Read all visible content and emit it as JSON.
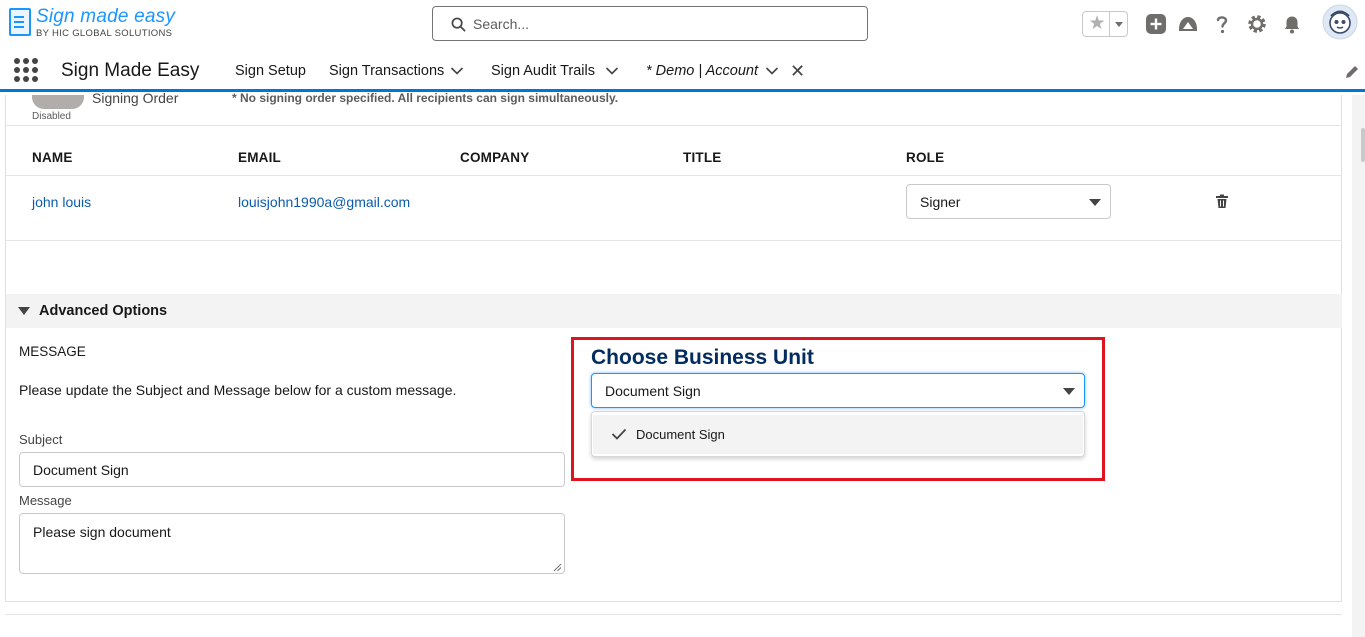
{
  "header": {
    "logo_title": "Sign made easy",
    "logo_subtitle": "BY HIC GLOBAL SOLUTIONS",
    "search_placeholder": "Search...",
    "icons": [
      "star-icon",
      "add-icon",
      "trailhead-icon",
      "help-icon",
      "gear-icon",
      "bell-icon",
      "avatar"
    ]
  },
  "nav": {
    "app_name": "Sign Made Easy",
    "items": [
      {
        "label": "Sign Setup"
      },
      {
        "label": "Sign Transactions"
      },
      {
        "label": "Sign Audit Trails"
      },
      {
        "label": "* Demo | Account"
      }
    ]
  },
  "signing_order": {
    "label": "Signing Order",
    "status": "Disabled",
    "note": "* No signing order specified. All recipients can sign simultaneously."
  },
  "recipients": {
    "columns": [
      "NAME",
      "EMAIL",
      "COMPANY",
      "TITLE",
      "ROLE"
    ],
    "rows": [
      {
        "name": "john louis",
        "email": "louisjohn1990a@gmail.com",
        "company": "",
        "title": "",
        "role": "Signer"
      }
    ]
  },
  "advanced": {
    "label": "Advanced Options",
    "message_heading": "MESSAGE",
    "message_help": "Please update the Subject and Message below for a custom message.",
    "subject_label": "Subject",
    "subject_value": "Document Sign",
    "message_label": "Message",
    "message_value": "Please sign document"
  },
  "business_unit": {
    "title": "Choose Business Unit",
    "selected": "Document Sign",
    "options": [
      "Document Sign"
    ]
  },
  "colors": {
    "brand_blue": "#0176d3",
    "link_blue": "#0b5cab",
    "highlight_red": "#e0141e",
    "heading_navy": "#032d60"
  }
}
